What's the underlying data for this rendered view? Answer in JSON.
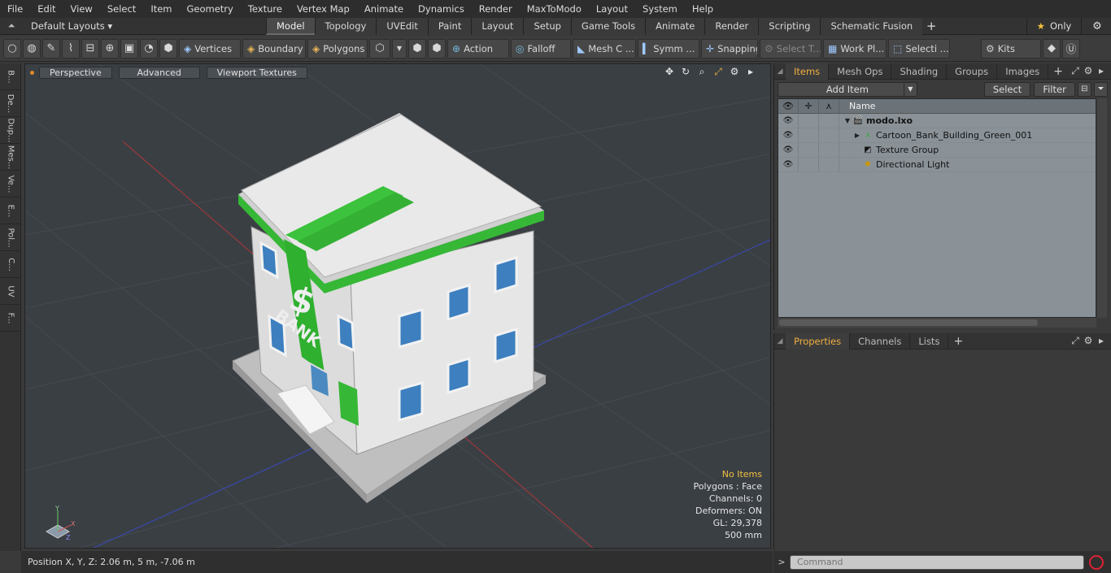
{
  "menu": [
    "File",
    "Edit",
    "View",
    "Select",
    "Item",
    "Geometry",
    "Texture",
    "Vertex Map",
    "Animate",
    "Dynamics",
    "Render",
    "MaxToModo",
    "Layout",
    "System",
    "Help"
  ],
  "layout": {
    "dropdown": "Default Layouts ▾"
  },
  "tabs": [
    "Model",
    "Topology",
    "UVEdit",
    "Paint",
    "Layout",
    "Setup",
    "Game Tools",
    "Animate",
    "Render",
    "Scripting",
    "Schematic Fusion"
  ],
  "active_tab": "Model",
  "only_label": "Only",
  "toolbar": {
    "vertices": "Vertices",
    "boundary": "Boundary",
    "polygons": "Polygons",
    "action": "Action",
    "falloff": "Falloff",
    "mesh_c": "Mesh C ...",
    "symm": "Symm ...",
    "snapping": "Snapping",
    "select_t": "Select T...",
    "work_pl": "Work Pl...",
    "selecti": "Selecti ...",
    "kits": "Kits"
  },
  "left_tabs": [
    "B...",
    "De...",
    "Dup...",
    "Mes...",
    "Ve...",
    "E...",
    "Pol...",
    "C...",
    "UV",
    "F..."
  ],
  "viewport": {
    "perspective": "Perspective",
    "advanced": "Advanced",
    "viewport_textures": "Viewport Textures",
    "info": {
      "items": "No Items",
      "polygons": "Polygons : Face",
      "channels": "Channels: 0",
      "deformers": "Deformers: ON",
      "gl": "GL: 29,378",
      "scale": "500 mm"
    },
    "sign_symbol": "$",
    "sign_text": "BANK",
    "axis": {
      "y": "Y",
      "x": "X",
      "z": "Z"
    }
  },
  "status": {
    "position": "Position X, Y, Z:   2.06 m, 5 m, -7.06 m"
  },
  "items_panel": {
    "tabs": [
      "Items",
      "Mesh Ops",
      "Shading",
      "Groups",
      "Images"
    ],
    "add_item": "Add Item",
    "select": "Select",
    "filter": "Filter",
    "column_name": "Name",
    "tree": [
      {
        "name": "modo.lxo",
        "level": 0,
        "expand": "▼",
        "icon": "scene-icon"
      },
      {
        "name": "Cartoon_Bank_Building_Green_001",
        "level": 1,
        "expand": "▶",
        "icon": "mesh-icon"
      },
      {
        "name": "Texture Group",
        "level": 1,
        "expand": "",
        "icon": "texture-group-icon"
      },
      {
        "name": "Directional Light",
        "level": 1,
        "expand": "",
        "icon": "light-icon"
      }
    ]
  },
  "properties_panel": {
    "tabs": [
      "Properties",
      "Channels",
      "Lists"
    ]
  },
  "command": {
    "placeholder": "Command"
  }
}
